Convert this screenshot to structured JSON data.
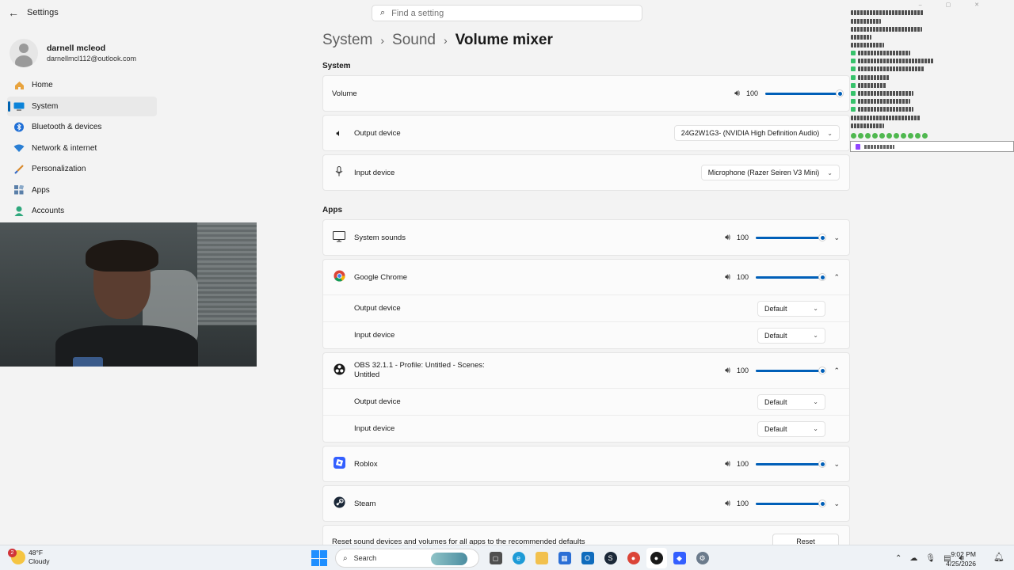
{
  "window": {
    "title": "Settings"
  },
  "search": {
    "placeholder": "Find a setting"
  },
  "profile": {
    "name": "darnell mcleod",
    "email": "darnellmcl112@outlook.com"
  },
  "sidebar": {
    "items": [
      {
        "label": "Home",
        "icon": "home-icon",
        "active": false
      },
      {
        "label": "System",
        "icon": "system-icon",
        "active": true
      },
      {
        "label": "Bluetooth & devices",
        "icon": "bluetooth-icon",
        "active": false
      },
      {
        "label": "Network & internet",
        "icon": "wifi-icon",
        "active": false
      },
      {
        "label": "Personalization",
        "icon": "brush-icon",
        "active": false
      },
      {
        "label": "Apps",
        "icon": "apps-icon",
        "active": false
      },
      {
        "label": "Accounts",
        "icon": "person-icon",
        "active": false
      }
    ]
  },
  "breadcrumb": {
    "level1": "System",
    "level2": "Sound",
    "level3": "Volume mixer",
    "sep": "›"
  },
  "system_section": {
    "title": "System",
    "volume_label": "Volume",
    "volume_value": "100",
    "volume_level": 1.0,
    "output_label": "Output device",
    "output_value": "24G2W1G3- (NVIDIA High Definition Audio)",
    "input_label": "Input device",
    "input_value": "Microphone (Razer Seiren V3 Mini)"
  },
  "apps_section": {
    "title": "Apps",
    "sub_output_label": "Output device",
    "sub_input_label": "Input device",
    "default_value": "Default",
    "apps": [
      {
        "name": "System sounds",
        "volume": "100",
        "level": 1.0,
        "expanded": false
      },
      {
        "name": "Google Chrome",
        "volume": "100",
        "level": 1.0,
        "expanded": true
      },
      {
        "name": "OBS 32.1.1 - Profile: Untitled - Scenes:",
        "name2": "Untitled",
        "volume": "100",
        "level": 1.0,
        "expanded": true
      },
      {
        "name": "Roblox",
        "volume": "100",
        "level": 1.0,
        "expanded": false
      },
      {
        "name": "Steam",
        "volume": "100",
        "level": 1.0,
        "expanded": false
      }
    ],
    "reset_text": "Reset sound devices and volumes for all apps to the recommended defaults",
    "reset_button": "Reset"
  },
  "taskbar": {
    "weather_temp": "48°F",
    "weather_desc": "Cloudy",
    "weather_badge": "2",
    "search_label": "Search",
    "time": "9:02 PM",
    "date": "4/25/2026"
  },
  "colors": {
    "accent": "#005fb8",
    "background": "#f3f3f3",
    "card": "#fbfbfb"
  }
}
